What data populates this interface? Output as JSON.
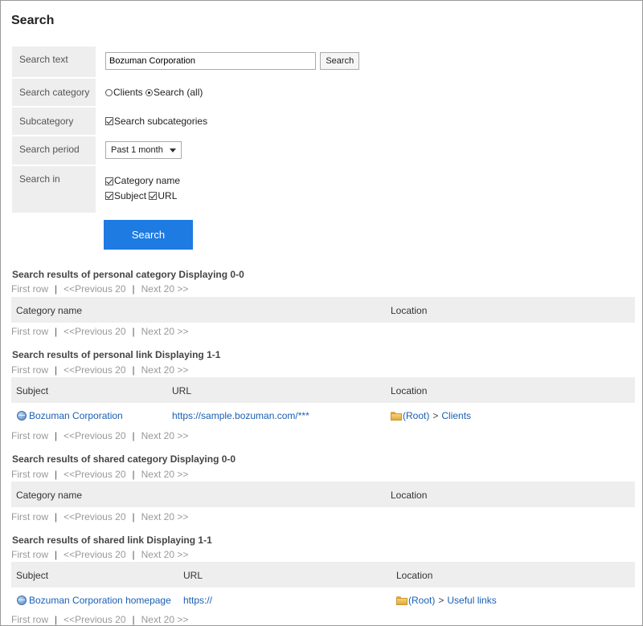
{
  "page_title": "Search",
  "form": {
    "search_text_label": "Search text",
    "search_text_value": "Bozuman Corporation",
    "search_button_small": "Search",
    "category_label": "Search category",
    "category_options": [
      "Clients",
      "Search (all)"
    ],
    "category_selected": "Search (all)",
    "subcategory_label": "Subcategory",
    "subcategory_option": "Search subcategories",
    "period_label": "Search period",
    "period_value": "Past 1 month",
    "search_in_label": "Search in",
    "search_in_options": [
      "Category name",
      "Subject",
      "URL"
    ],
    "search_button": "Search"
  },
  "pager": {
    "first": "First row",
    "prev": "<<Previous 20",
    "next": "Next 20 >>",
    "sep": "|"
  },
  "sections": {
    "personal_category": {
      "title": "Search results of personal category Displaying 0-0",
      "col_name": "Category name",
      "col_location": "Location"
    },
    "personal_link": {
      "title": "Search results of personal link Displaying 1-1",
      "col_subject": "Subject",
      "col_url": "URL",
      "col_location": "Location",
      "rows": [
        {
          "subject": "Bozuman Corporation",
          "url": "https://sample.bozuman.com/***",
          "loc_root": "(Root)",
          "loc_sep": ">",
          "loc_child": "Clients"
        }
      ]
    },
    "shared_category": {
      "title": "Search results of shared category Displaying 0-0",
      "col_name": "Category name",
      "col_location": "Location"
    },
    "shared_link": {
      "title": "Search results of shared link Displaying 1-1",
      "col_subject": "Subject",
      "col_url": "URL",
      "col_location": "Location",
      "rows": [
        {
          "subject": "Bozuman Corporation homepage",
          "url": "https://",
          "loc_root": "(Root)",
          "loc_sep": ">",
          "loc_child": "Useful links"
        }
      ]
    }
  }
}
